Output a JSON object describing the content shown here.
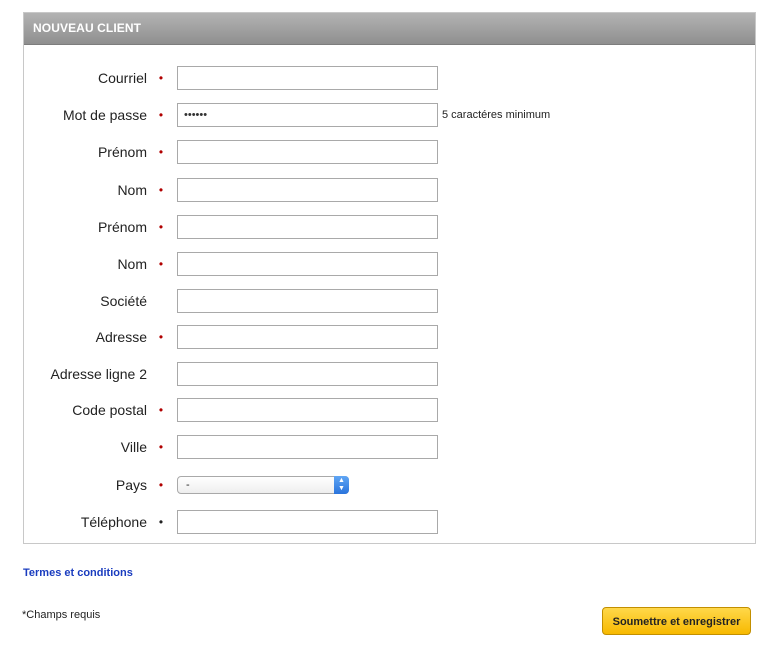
{
  "panel": {
    "title": "NOUVEAU CLIENT"
  },
  "form": {
    "fields": [
      {
        "label": "Courriel",
        "required": true,
        "value": ""
      },
      {
        "label": "Mot de passe",
        "required": true,
        "value": "••••••",
        "hint": "5 caractéres minimum"
      },
      {
        "label": "Prénom",
        "required": true,
        "value": ""
      },
      {
        "label": "Nom",
        "required": true,
        "value": ""
      },
      {
        "label": "Prénom",
        "required": true,
        "value": ""
      },
      {
        "label": "Nom",
        "required": true,
        "value": ""
      },
      {
        "label": "Société",
        "required": false,
        "value": ""
      },
      {
        "label": "Adresse",
        "required": true,
        "value": ""
      },
      {
        "label": "Adresse ligne 2",
        "required": false,
        "value": ""
      },
      {
        "label": "Code postal",
        "required": true,
        "value": ""
      },
      {
        "label": "Ville",
        "required": true,
        "value": ""
      },
      {
        "label": "Pays",
        "required": true,
        "value": "-"
      },
      {
        "label": "Téléphone",
        "required": true,
        "value": ""
      }
    ],
    "required_marker": "•"
  },
  "links": {
    "terms": "Termes et conditions"
  },
  "footer": {
    "required_note": "*Champs requis",
    "submit_label": "Soumettre et enregistrer"
  },
  "icons": {
    "select_arrows": "chevron-updown-icon"
  },
  "colors": {
    "required_marker": "#b10000",
    "link": "#1a3cbf",
    "submit_button": "#f7b900",
    "header_bar": "#9e9e9e"
  }
}
